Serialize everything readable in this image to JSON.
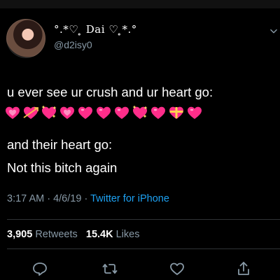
{
  "tweet": {
    "display_name": "°.*♡ ̥ Dai ♡ ̥*.°",
    "handle": "@d2isy0",
    "line1": "u ever see ur crush and ur heart go:",
    "line3": "and their heart go:",
    "line4": "Not this bitch again",
    "emoji_icons": [
      "growing-heart",
      "heart-with-arrow",
      "sparkling-heart",
      "growing-heart",
      "pink-heart",
      "pink-heart",
      "pink-heart",
      "sparkling-heart",
      "pink-heart",
      "heart-with-ribbon",
      "pink-heart"
    ],
    "time": "3:17 AM",
    "date": "4/6/19",
    "source": "Twitter for iPhone",
    "retweets_count": "3,905",
    "retweets_label": "Retweets",
    "likes_count": "15.4K",
    "likes_label": "Likes"
  },
  "colors": {
    "background": "#000000",
    "muted": "#8899a6",
    "link": "#1da1f2",
    "heart": "#ff2d8a"
  },
  "icons": [
    "avatar",
    "chevron-down-icon",
    "reply-icon",
    "retweet-icon",
    "like-icon",
    "share-icon"
  ]
}
